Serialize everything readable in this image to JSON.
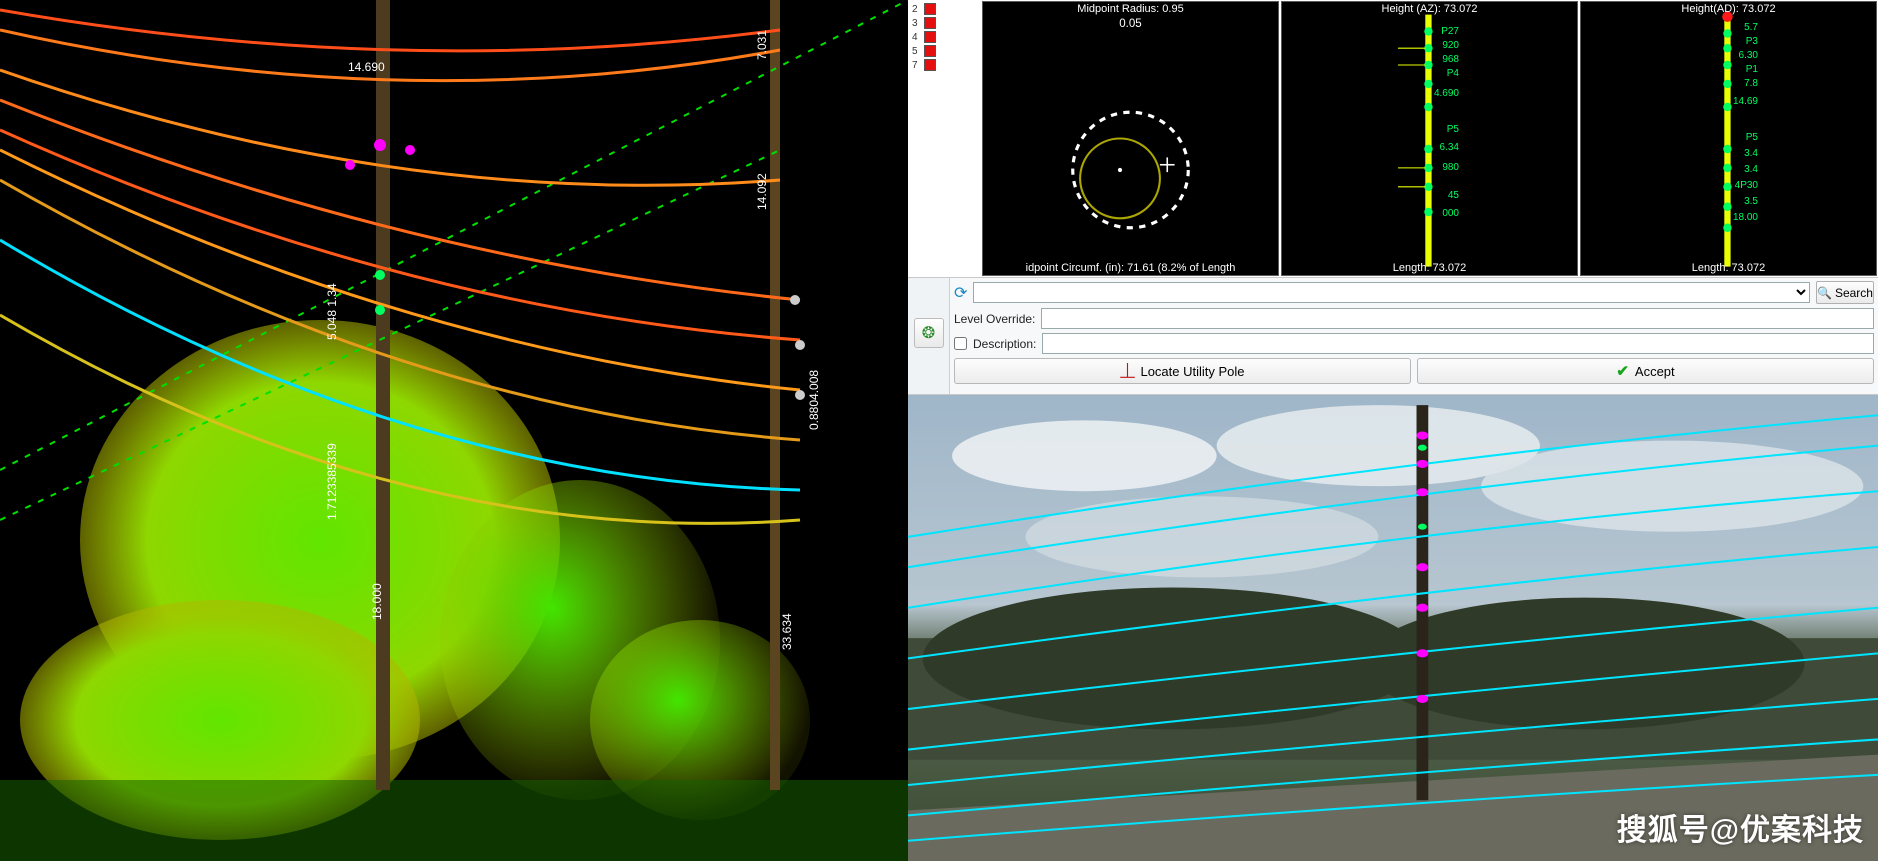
{
  "legend": {
    "rows": [
      {
        "label": "2",
        "color": "#e40f0f"
      },
      {
        "label": "3",
        "color": "#e40f0f"
      },
      {
        "label": "4",
        "color": "#e40f0f"
      },
      {
        "label": "5",
        "color": "#e40f0f"
      },
      {
        "label": "7",
        "color": "#e40f0f"
      }
    ]
  },
  "miniViews": {
    "midpoint": {
      "title": "Midpoint Radius: 0.95",
      "bottom": "idpoint Circumf. (in): 71.61  (8.2% of Length",
      "center_value": "0.05"
    },
    "heightAZ": {
      "title": "Height (AZ): 73.072",
      "bottom": "Length: 73.072",
      "markers": [
        "P27",
        "920",
        "968",
        "P4",
        "4.690",
        "P5",
        "6.34",
        "980",
        "45",
        "000"
      ]
    },
    "heightAD": {
      "title": "Height(AD): 73.072",
      "bottom": "Length: 73.072",
      "markers": [
        "5.7",
        "P3",
        "6.30",
        "P1",
        "7.8",
        "14.69",
        "P5",
        "3.4",
        "3.4",
        "4P30",
        "3.5",
        "18.00"
      ]
    }
  },
  "controls": {
    "search_dropdown_value": "",
    "search_btn": "Search",
    "level_override_label": "Level Override:",
    "level_override_value": "",
    "description_label": "Description:",
    "description_checked": false,
    "description_value": "",
    "locate_btn": "Locate Utility Pole",
    "accept_btn": "Accept"
  },
  "mainview": {
    "labels": {
      "top_pole": "14.690",
      "right_1": "7.031",
      "right_2": "14.092",
      "mid_left_1": "5.048 1.34",
      "mid_left_2": "1.7123385339",
      "ground": "18.000",
      "right_3": "0.8804.008",
      "right_4": "33.634"
    }
  },
  "watermark": "搜狐号@优案科技"
}
